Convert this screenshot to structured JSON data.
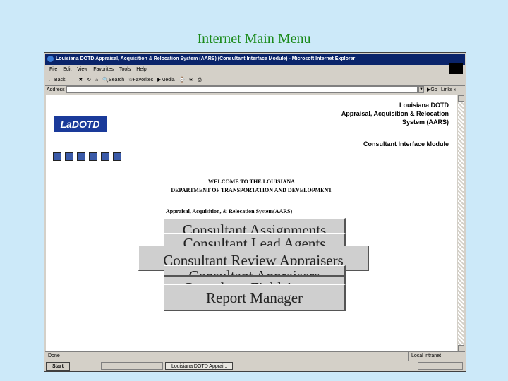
{
  "slide": {
    "title": "Internet Main Menu"
  },
  "browser": {
    "window_title": "Louisiana DOTD Appraisal, Acquisition & Relocation System (AARS) (Consultant Interface Module) - Microsoft Internet Explorer",
    "menu": [
      "File",
      "Edit",
      "View",
      "Favorites",
      "Tools",
      "Help"
    ],
    "toolbar": {
      "back": "Back",
      "search": "Search",
      "favorites": "Favorites",
      "media": "Media"
    },
    "address_label": "Address",
    "address_value": "",
    "go_label": "Go",
    "links_label": "Links"
  },
  "page": {
    "org_name": "Louisiana DOTD",
    "org_line2": "Appraisal, Acquisition & Relocation",
    "org_line3": "System (AARS)",
    "module": "Consultant Interface Module",
    "logo_text": "LaDOTD",
    "welcome_line1": "WELCOME TO THE LOUISIANA",
    "welcome_line2": "DEPARTMENT OF TRANSPORTATION AND DEVELOPMENT",
    "system_name": "Appraisal, Acquisition, & Relocation System(AARS)"
  },
  "menu_buttons": [
    {
      "label": "Consultant Assignments"
    },
    {
      "label": "Consultant Lead Agents"
    },
    {
      "label": "Consultant Review Appraisers"
    },
    {
      "label": "Consultant Appraisers"
    },
    {
      "label": "Consultant Field Agents"
    },
    {
      "label": "Report Manager"
    }
  ],
  "status": {
    "left": "Done",
    "right": "Local intranet"
  },
  "taskbar": {
    "start": "Start",
    "task1": "",
    "task2": "Louisiana DOTD Apprai...",
    "clock": ""
  }
}
